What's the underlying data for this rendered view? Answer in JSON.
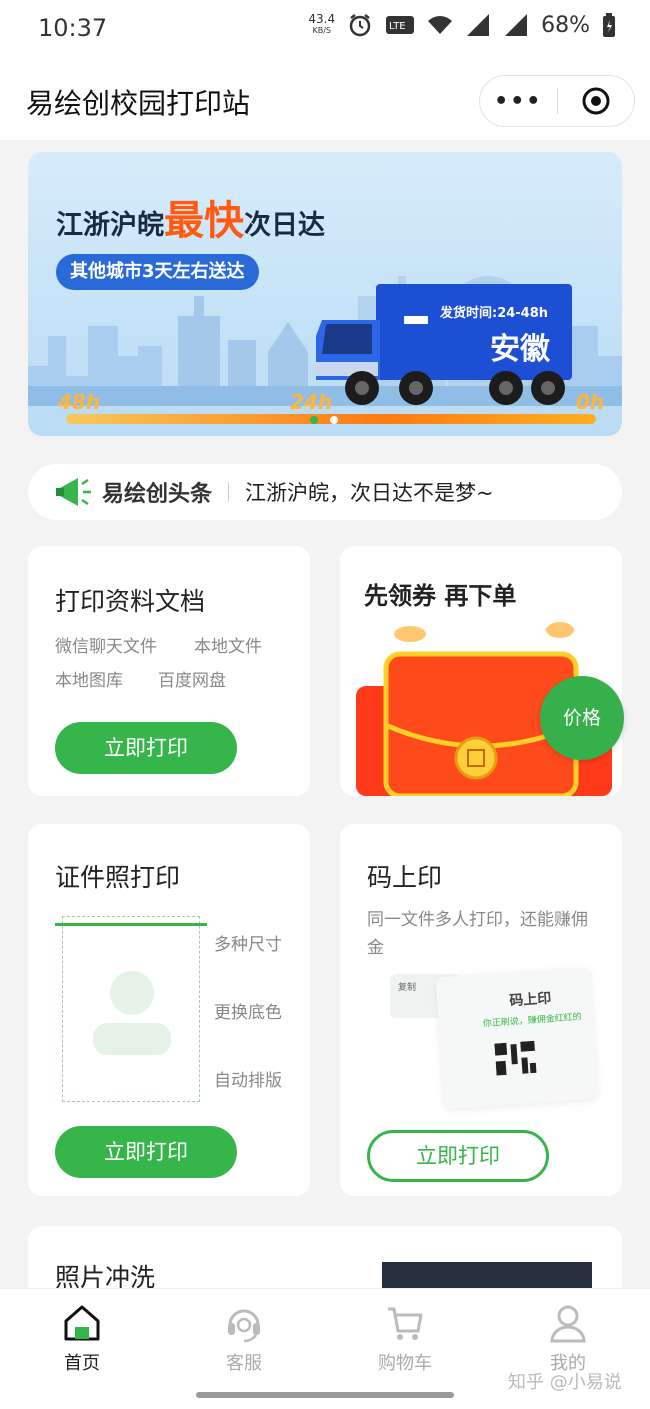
{
  "status_bar": {
    "time": "10:37",
    "net_speed_value": "43.4",
    "net_speed_unit": "KB/S",
    "battery": "68%"
  },
  "nav": {
    "title": "易绘创校园打印站",
    "more": "•••"
  },
  "banner": {
    "headline_pre": "江浙沪皖",
    "headline_highlight": "最快",
    "headline_post": "次日达",
    "pill": "其他城市3天左右送达",
    "truck_time": "发货时间:24-48h",
    "truck_dest": "安徽",
    "timeline": [
      "48h",
      "24h",
      "0h"
    ]
  },
  "news": {
    "brand": "易绘创头条",
    "text": "江浙沪皖，次日达不是梦~"
  },
  "cards": {
    "docs": {
      "title": "打印资料文档",
      "tags": [
        "微信聊天文件",
        "本地文件",
        "本地图库",
        "百度网盘"
      ],
      "button": "立即打印"
    },
    "coupon": {
      "title": "先领券  再下单",
      "badge": "价格"
    },
    "id_photo": {
      "title": "证件照打印",
      "features": [
        "多种尺寸",
        "更换底色",
        "自动排版"
      ],
      "button": "立即打印"
    },
    "qr_print": {
      "title": "码上印",
      "desc": "同一文件多人打印，还能赚佣金",
      "paper_title": "码上印",
      "paper_sub": "你正刷说，赚佣金红红的",
      "tag": "复制",
      "button": "立即打印"
    },
    "photo": {
      "title": "照片冲洗"
    }
  },
  "tabs": [
    {
      "label": "首页",
      "icon": "home-icon",
      "active": true
    },
    {
      "label": "客服",
      "icon": "headset-icon",
      "active": false
    },
    {
      "label": "购物车",
      "icon": "cart-icon",
      "active": false
    },
    {
      "label": "我的",
      "icon": "user-icon",
      "active": false
    }
  ],
  "watermark": "知乎 @小易说",
  "colors": {
    "brand_green": "#36b54a",
    "banner_orange": "#ff5a10",
    "banner_blue": "#2a6ad8"
  }
}
